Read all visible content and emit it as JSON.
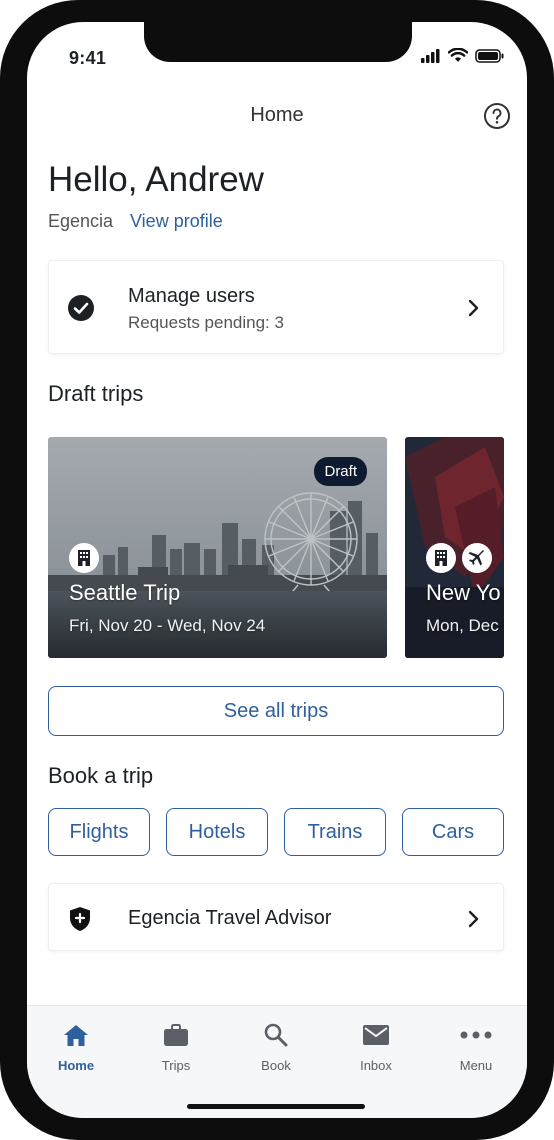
{
  "status_bar": {
    "time": "9:41"
  },
  "header": {
    "title": "Home"
  },
  "greeting": {
    "text": "Hello, Andrew",
    "company": "Egencia",
    "view_profile": "View profile"
  },
  "manage_users": {
    "title": "Manage users",
    "subtitle": "Requests pending: 3"
  },
  "draft_trips": {
    "section_title": "Draft trips",
    "trips": [
      {
        "name": "Seattle Trip",
        "dates": "Fri, Nov 20 - Wed, Nov 24",
        "badge": "Draft",
        "icons": [
          "hotel-icon"
        ]
      },
      {
        "name": "New Yo",
        "dates": "Mon, Dec",
        "icons": [
          "hotel-icon",
          "flight-icon"
        ]
      }
    ],
    "see_all": "See all trips"
  },
  "book": {
    "section_title": "Book a trip",
    "options": [
      "Flights",
      "Hotels",
      "Trains",
      "Cars"
    ]
  },
  "advisor": {
    "title": "Egencia Travel Advisor"
  },
  "tabbar": {
    "tabs": [
      {
        "label": "Home",
        "icon": "home-icon",
        "active": true
      },
      {
        "label": "Trips",
        "icon": "briefcase-icon"
      },
      {
        "label": "Book",
        "icon": "search-icon"
      },
      {
        "label": "Inbox",
        "icon": "mail-icon"
      },
      {
        "label": "Menu",
        "icon": "more-icon"
      }
    ]
  },
  "colors": {
    "accent": "#2f5f9e",
    "badge": "#0e1a2f",
    "text": "#1d2125"
  }
}
